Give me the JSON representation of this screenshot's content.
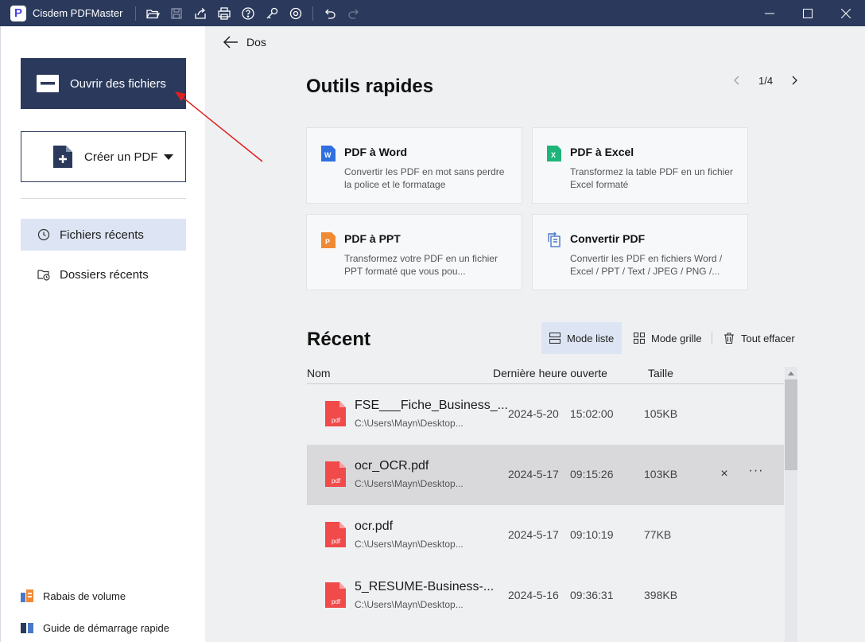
{
  "app": {
    "title": "Cisdem PDFMaster",
    "logo_letter": "P"
  },
  "titlebar_icons": [
    "open-folder-icon",
    "save-icon",
    "share-icon",
    "print-icon",
    "help-icon",
    "key-icon",
    "settings-icon",
    "undo-icon",
    "redo-icon"
  ],
  "sidebar": {
    "open_label": "Ouvrir des fichiers",
    "create_label": "Créer un PDF",
    "nav": [
      {
        "label": "Fichiers récents",
        "icon": "clock-icon",
        "active": true
      },
      {
        "label": "Dossiers récents",
        "icon": "folder-clock-icon",
        "active": false
      }
    ],
    "bottom": [
      {
        "label": "Rabais de volume",
        "icon": "volume-discount-icon"
      },
      {
        "label": "Guide de démarrage rapide",
        "icon": "book-icon"
      }
    ]
  },
  "main": {
    "back_label": "Dos",
    "tools_title": "Outils rapides",
    "pager": "1/4",
    "tools": [
      {
        "title": "PDF à Word",
        "desc": "Convertir les PDF en mot sans perdre la police et le formatage",
        "icon": "word-icon",
        "color": "#2f6fe0"
      },
      {
        "title": "PDF à Excel",
        "desc": "Transformez la table PDF en un fichier Excel formaté",
        "icon": "excel-icon",
        "color": "#1fb57a"
      },
      {
        "title": "PDF à PPT",
        "desc": "Transformez votre PDF en un fichier PPT formaté que vous pou...",
        "icon": "ppt-icon",
        "color": "#f08a35"
      },
      {
        "title": "Convertir PDF",
        "desc": "Convertir les PDF en fichiers Word / Excel / PPT / Text / JPEG / PNG /...",
        "icon": "convert-icon",
        "color": "#4a78c8"
      }
    ],
    "recent_title": "Récent",
    "modes": {
      "list": "Mode liste",
      "grid": "Mode grille",
      "clear": "Tout effacer"
    },
    "columns": {
      "name": "Nom",
      "last_opened": "Dernière heure ouverte",
      "size": "Taille"
    },
    "files": [
      {
        "name": "FSE___Fiche_Business_...",
        "path": "C:\\Users\\Mayn\\Desktop...",
        "date": "2024-5-20",
        "time": "15:02:00",
        "size": "105KB",
        "selected": false
      },
      {
        "name": "ocr_OCR.pdf",
        "path": "C:\\Users\\Mayn\\Desktop...",
        "date": "2024-5-17",
        "time": "09:15:26",
        "size": "103KB",
        "selected": true
      },
      {
        "name": "ocr.pdf",
        "path": "C:\\Users\\Mayn\\Desktop...",
        "date": "2024-5-17",
        "time": "09:10:19",
        "size": "77KB",
        "selected": false
      },
      {
        "name": "5_RESUME-Business-...",
        "path": "C:\\Users\\Mayn\\Desktop...",
        "date": "2024-5-16",
        "time": "09:36:31",
        "size": "398KB",
        "selected": false
      }
    ],
    "row_actions": {
      "close": "×",
      "more": "···"
    },
    "pdf_badge": "pdf"
  },
  "colors": {
    "navy": "#2b3a5c",
    "active_bg": "#dde4f3",
    "pdf_red": "#f04a4a",
    "annotation_red": "#e02020"
  }
}
